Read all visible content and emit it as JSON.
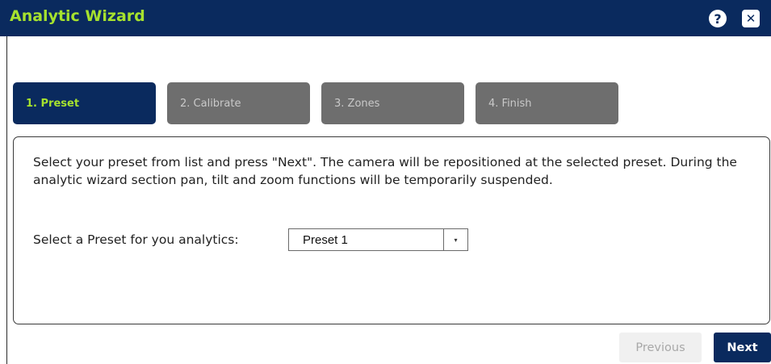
{
  "window": {
    "title": "Analytic Wizard",
    "help_label": "?",
    "close_label": "✕"
  },
  "steps": [
    {
      "label": "1. Preset",
      "state": "active"
    },
    {
      "label": "2. Calibrate",
      "state": "inactive"
    },
    {
      "label": "3. Zones",
      "state": "inactive"
    },
    {
      "label": "4. Finish",
      "state": "inactive"
    }
  ],
  "panel": {
    "instructions": "Select your preset from list and press \"Next\". The camera will be repositioned at the selected preset. During the analytic wizard section pan, tilt and zoom functions will be temporarily suspended.",
    "preset_label": "Select a Preset for you analytics:",
    "preset_value": "Preset 1",
    "preset_arrow": "▾"
  },
  "footer": {
    "previous_label": "Previous",
    "previous_enabled": false,
    "next_label": "Next"
  },
  "colors": {
    "header_bg": "#0a2a5e",
    "title_accent": "#a6e22e",
    "step_inactive": "#6e6e6e"
  }
}
